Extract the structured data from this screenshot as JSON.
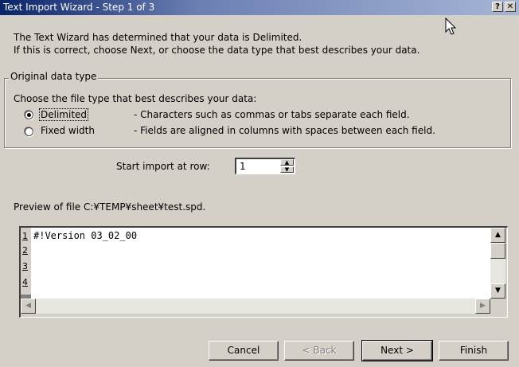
{
  "window": {
    "title": "Text Import Wizard - Step 1 of 3",
    "help_btn": "?",
    "close_btn": "✕"
  },
  "intro": {
    "line1": "The Text Wizard has determined that your data is Delimited.",
    "line2": "If this is correct, choose Next, or choose the data type that best describes your data."
  },
  "original_data_type": {
    "legend": "Original data type",
    "prompt": "Choose the file type that best describes your data:",
    "options": [
      {
        "label": "Delimited",
        "desc": "- Characters such as commas or tabs separate each field.",
        "selected": true
      },
      {
        "label": "Fixed width",
        "desc": "- Fields are aligned in columns with spaces between each field.",
        "selected": false
      }
    ]
  },
  "start_row": {
    "label": "Start import at row:",
    "value": "1"
  },
  "preview": {
    "label": "Preview of file C:¥TEMP¥sheet¥test.spd.",
    "rows": [
      {
        "num": "1",
        "text": "#!Version 03_02_00"
      },
      {
        "num": "2",
        "text": ""
      },
      {
        "num": "3",
        "text": ""
      },
      {
        "num": "4",
        "text": ""
      }
    ]
  },
  "buttons": {
    "cancel": "Cancel",
    "back": "< Back",
    "next": "Next >",
    "finish": "Finish"
  },
  "icons": [
    "help-icon",
    "close-icon",
    "mouse-cursor-icon",
    "spin-up-icon",
    "spin-down-icon",
    "scroll-up-icon",
    "scroll-down-icon",
    "scroll-left-icon",
    "scroll-right-icon"
  ]
}
